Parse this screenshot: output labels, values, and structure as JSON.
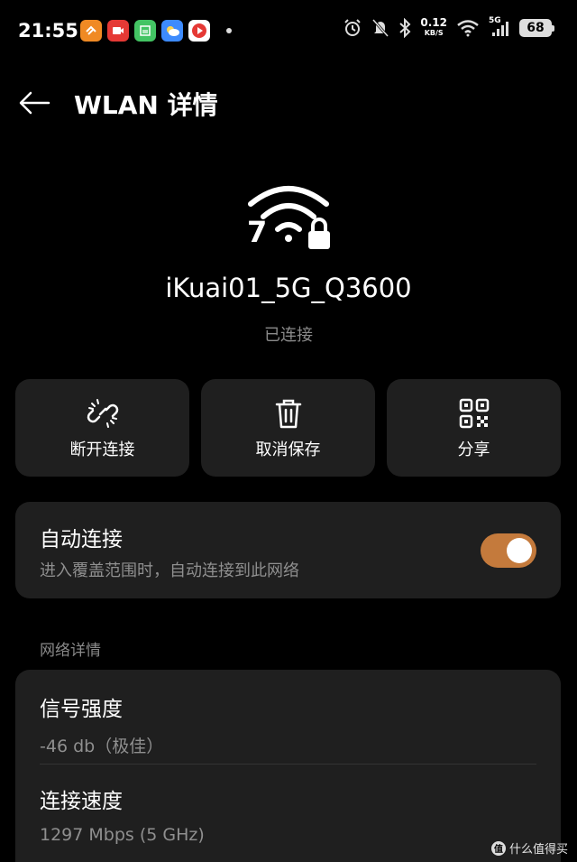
{
  "status_bar": {
    "time": "21:55",
    "app_icons": [
      "app-icon-orange",
      "app-icon-red",
      "app-icon-green",
      "app-icon-weather",
      "app-icon-red-play"
    ],
    "net_speed": "0.12",
    "net_unit": "KB/S",
    "cellular": "5G",
    "battery": "68"
  },
  "header": {
    "title": "WLAN 详情"
  },
  "network": {
    "wifi_badge": "7",
    "ssid": "iKuai01_5G_Q3600",
    "status": "已连接"
  },
  "actions": [
    {
      "label": "断开连接",
      "icon": "unlink-icon"
    },
    {
      "label": "取消保存",
      "icon": "trash-icon"
    },
    {
      "label": "分享",
      "icon": "qr-code-icon"
    }
  ],
  "auto_connect": {
    "title": "自动连接",
    "description": "进入覆盖范围时，自动连接到此网络",
    "enabled": true
  },
  "details": {
    "section_label": "网络详情",
    "signal_label": "信号强度",
    "signal_value": "-46 db（极佳）",
    "speed_label": "连接速度",
    "speed_value": "1297 Mbps (5 GHz)"
  },
  "colors": {
    "accent": "#c47a3c",
    "card_bg": "#1f1f1f",
    "secondary_text": "#8f8f8f"
  },
  "watermark": {
    "text": "值 什么值得买",
    "logo": "值"
  }
}
